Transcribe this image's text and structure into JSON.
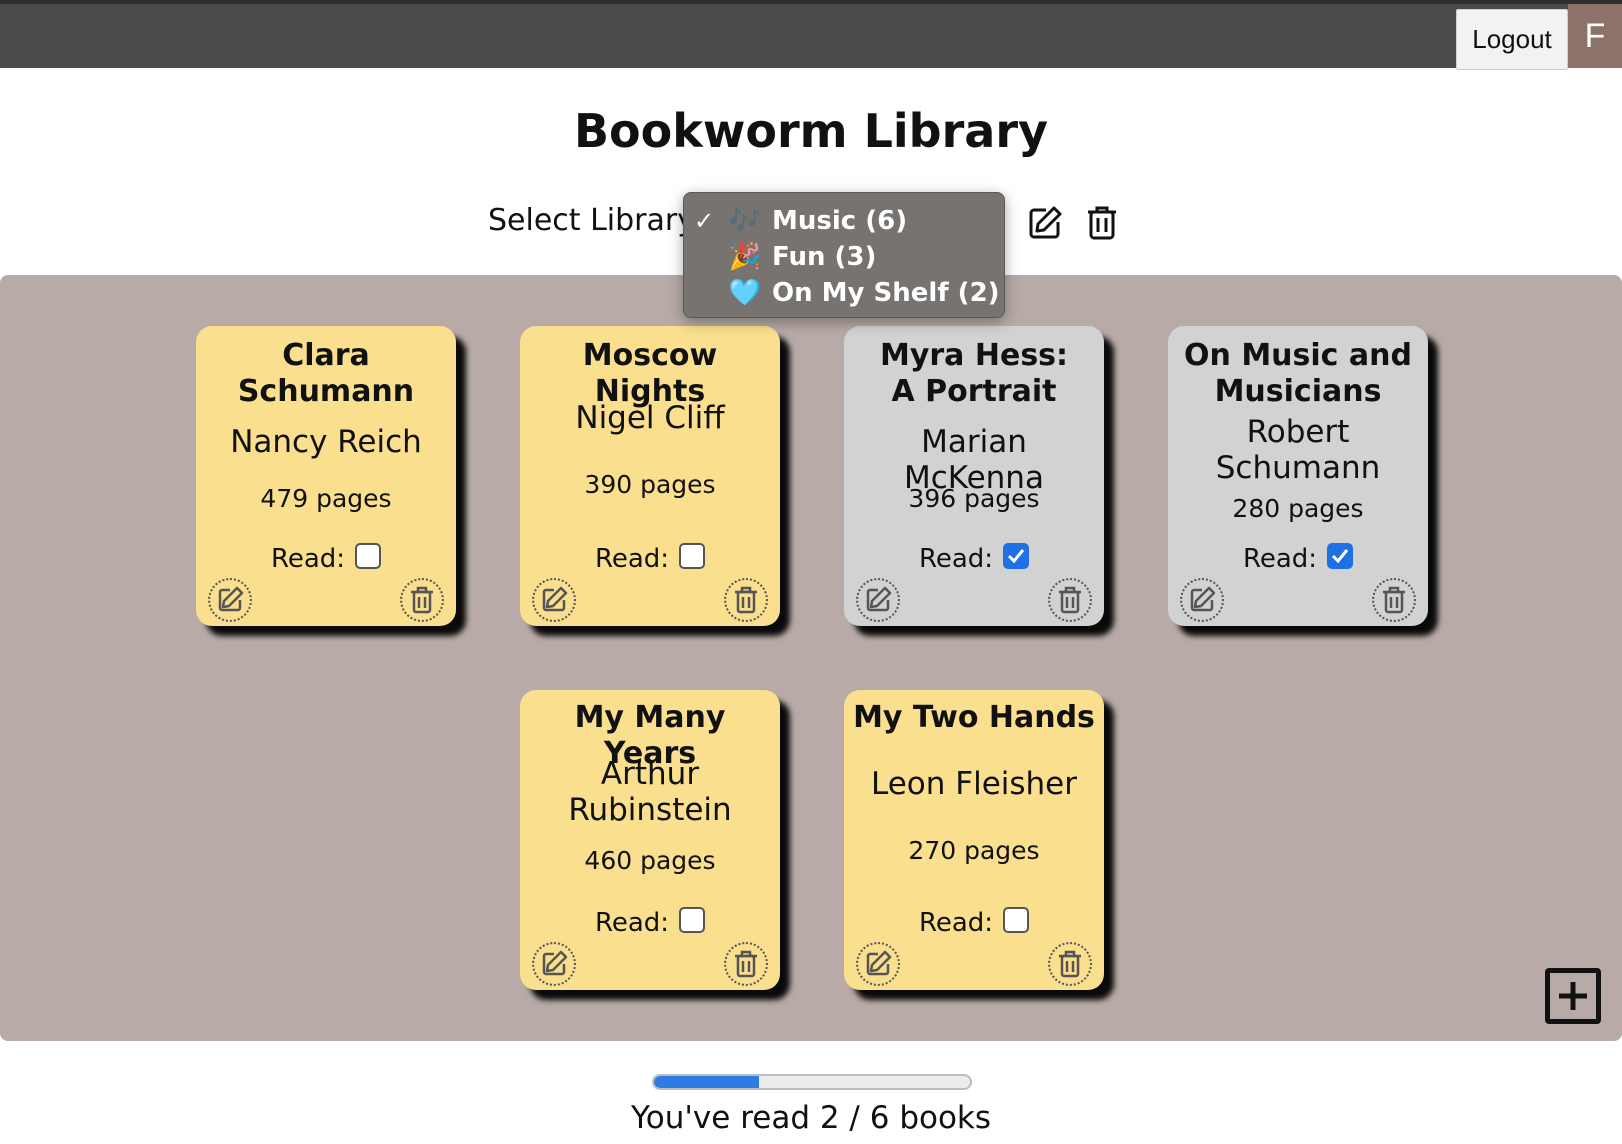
{
  "topbar": {
    "logout_label": "Logout",
    "avatar_initial": "F"
  },
  "page_title": "Bookworm Library",
  "library_selector": {
    "label": "Select Library",
    "icons": [
      "add-library-icon",
      "edit-library-icon",
      "delete-library-icon"
    ],
    "options": [
      {
        "emoji": "🎶",
        "label": "Music (6)",
        "selected": true,
        "check": "✓"
      },
      {
        "emoji": "🎉",
        "label": "Fun (3)",
        "selected": false,
        "check": ""
      },
      {
        "emoji": "🩵",
        "label": "On My Shelf (2)",
        "selected": false,
        "check": ""
      }
    ]
  },
  "books": [
    {
      "title": "Clara Schumann",
      "author": "Nancy Reich",
      "pages": "479 pages",
      "read_label": "Read:",
      "read": false
    },
    {
      "title": "Moscow Nights",
      "author": "Nigel Cliff",
      "pages": "390 pages",
      "read_label": "Read:",
      "read": false
    },
    {
      "title": "Myra Hess: A Portrait",
      "author": "Marian McKenna",
      "pages": "396 pages",
      "read_label": "Read:",
      "read": true
    },
    {
      "title": "On Music and Musicians",
      "author": "Robert Schumann",
      "pages": "280 pages",
      "read_label": "Read:",
      "read": true
    },
    {
      "title": "My Many Years",
      "author": "Arthur Rubinstein",
      "pages": "460 pages",
      "read_label": "Read:",
      "read": false
    },
    {
      "title": "My Two Hands",
      "author": "Leon Fleisher",
      "pages": "270 pages",
      "read_label": "Read:",
      "read": false
    }
  ],
  "colors": {
    "unread_card": "#fadf8f",
    "read_card": "#d3d2d2",
    "shelf": "#b8aba7",
    "topbar": "#4a4a4a",
    "accent": "#2f7be6"
  },
  "progress": {
    "read": 2,
    "total": 6,
    "text": "You've read 2 / 6 books"
  }
}
